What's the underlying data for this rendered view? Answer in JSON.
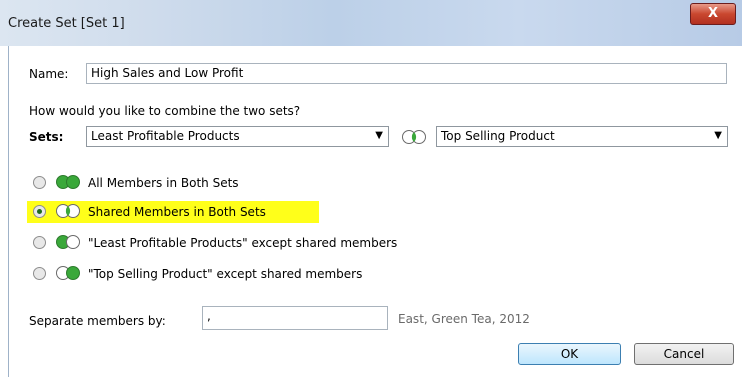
{
  "dialog": {
    "title": "Create Set [Set 1]",
    "close_glyph": "X"
  },
  "name_field": {
    "label": "Name:",
    "value": "High Sales and Low Profit"
  },
  "combine_prompt": "How would you like to combine the two sets?",
  "sets": {
    "label": "Sets:",
    "left_set": "Least Profitable Products",
    "right_set": "Top Selling Product",
    "dropdown_arrow": "▼"
  },
  "options": [
    {
      "label": "All Members in Both Sets",
      "selected": false,
      "icon": "venn-union-icon"
    },
    {
      "label": "Shared Members in Both Sets",
      "selected": true,
      "icon": "venn-intersection-icon"
    },
    {
      "label": "\"Least Profitable Products\" except shared members",
      "selected": false,
      "icon": "venn-left-only-icon"
    },
    {
      "label": "\"Top Selling Product\" except shared members",
      "selected": false,
      "icon": "venn-right-only-icon"
    }
  ],
  "separator": {
    "label": "Separate members by:",
    "value": ",",
    "example": "East, Green Tea, 2012"
  },
  "buttons": {
    "ok": "OK",
    "cancel": "Cancel"
  },
  "colors": {
    "venn_green": "#3aa83a",
    "highlight": "#ffff1a",
    "selected_radio": "#1e6b1e"
  }
}
